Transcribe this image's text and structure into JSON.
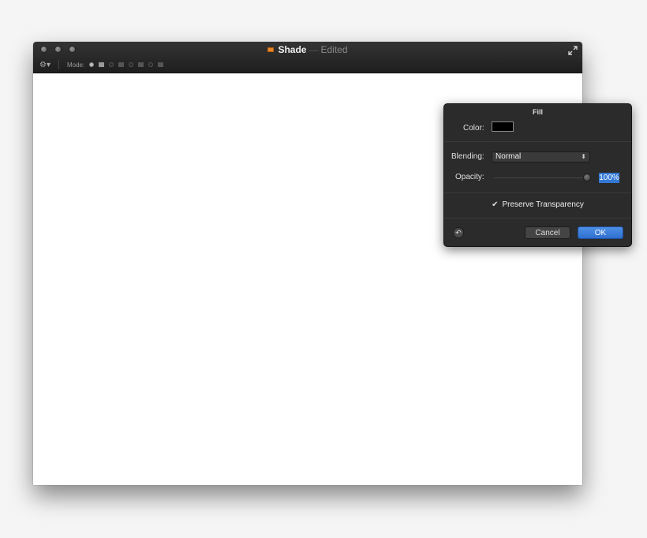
{
  "window": {
    "doc_name": "Shade",
    "dash": "—",
    "status": "Edited"
  },
  "toolbar": {
    "mode_label": "Mode:",
    "gear_glyph": "⚙▾"
  },
  "fill_panel": {
    "title": "Fill",
    "color_label": "Color:",
    "color_value": "#000000",
    "blending_label": "Blending:",
    "blending_value": "Normal",
    "opacity_label": "Opacity:",
    "opacity_value": "100%",
    "opacity_level": 1.0,
    "preserve_label": "Preserve Transparency",
    "preserve_checked": true,
    "cancel_label": "Cancel",
    "ok_label": "OK",
    "accent_color": "#3478d6"
  }
}
